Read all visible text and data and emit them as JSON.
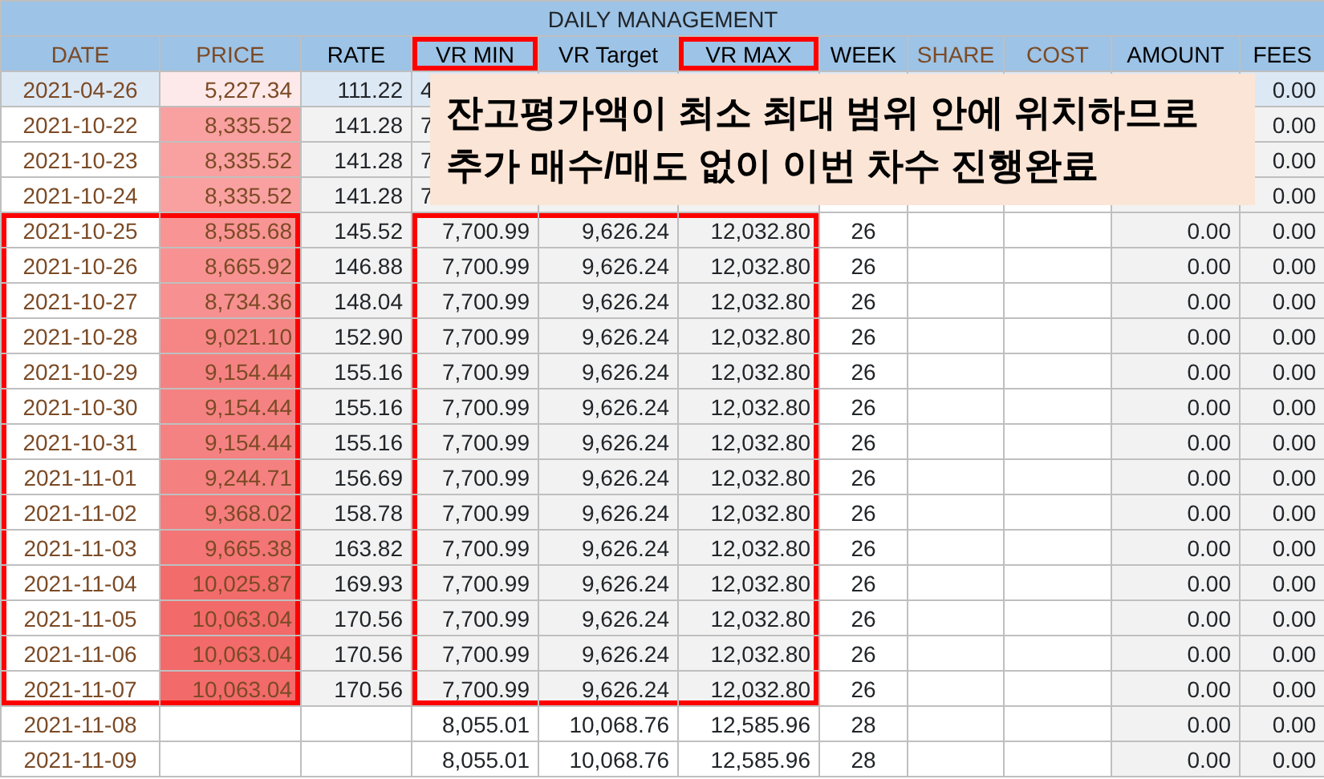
{
  "table": {
    "title": "DAILY MANAGEMENT",
    "columns": [
      {
        "label": "DATE",
        "kind": "input",
        "marked_header": false,
        "marked_body": true
      },
      {
        "label": "PRICE",
        "kind": "input",
        "marked_header": false,
        "marked_body": true
      },
      {
        "label": "RATE",
        "kind": "derived",
        "marked_header": false,
        "marked_body": false
      },
      {
        "label": "VR MIN",
        "kind": "derived",
        "marked_header": true,
        "marked_body": true
      },
      {
        "label": "VR Target",
        "kind": "derived",
        "marked_header": false,
        "marked_body": true
      },
      {
        "label": "VR MAX",
        "kind": "derived",
        "marked_header": true,
        "marked_body": true
      },
      {
        "label": "WEEK",
        "kind": "derived",
        "marked_header": false,
        "marked_body": false
      },
      {
        "label": "SHARE",
        "kind": "input",
        "marked_header": false,
        "marked_body": false
      },
      {
        "label": "COST",
        "kind": "input",
        "marked_header": false,
        "marked_body": false
      },
      {
        "label": "AMOUNT",
        "kind": "derived",
        "marked_header": false,
        "marked_body": false
      },
      {
        "label": "FEES",
        "kind": "derived",
        "marked_header": false,
        "marked_body": false
      }
    ],
    "rows": [
      {
        "kind": "baseline",
        "marked": false,
        "color": "#fde9e9",
        "cells": [
          "2021-04-26",
          "5,227.34",
          "111.22",
          "4",
          null,
          null,
          null,
          null,
          null,
          null,
          "0.00"
        ]
      },
      {
        "kind": "daily",
        "marked": false,
        "color": "#f9a0a0",
        "cells": [
          "2021-10-22",
          "8,335.52",
          "141.28",
          "7",
          null,
          null,
          null,
          null,
          null,
          null,
          "0.00"
        ]
      },
      {
        "kind": "daily",
        "marked": false,
        "color": "#f9a0a0",
        "cells": [
          "2021-10-23",
          "8,335.52",
          "141.28",
          "7",
          null,
          null,
          null,
          null,
          null,
          null,
          "0.00"
        ]
      },
      {
        "kind": "daily",
        "marked": false,
        "color": "#f9a0a0",
        "cells": [
          "2021-10-24",
          "8,335.52",
          "141.28",
          "7",
          null,
          null,
          null,
          null,
          null,
          null,
          "0.00"
        ]
      },
      {
        "kind": "daily",
        "marked": true,
        "color": "#f89494",
        "cells": [
          "2021-10-25",
          "8,585.68",
          "145.52",
          "7,700.99",
          "9,626.24",
          "12,032.80",
          "26",
          null,
          null,
          "0.00",
          "0.00"
        ]
      },
      {
        "kind": "daily",
        "marked": true,
        "color": "#f89292",
        "cells": [
          "2021-10-26",
          "8,665.92",
          "146.88",
          "7,700.99",
          "9,626.24",
          "12,032.80",
          "26",
          null,
          null,
          "0.00",
          "0.00"
        ]
      },
      {
        "kind": "daily",
        "marked": true,
        "color": "#f79090",
        "cells": [
          "2021-10-27",
          "8,734.36",
          "148.04",
          "7,700.99",
          "9,626.24",
          "12,032.80",
          "26",
          null,
          null,
          "0.00",
          "0.00"
        ]
      },
      {
        "kind": "daily",
        "marked": true,
        "color": "#f68686",
        "cells": [
          "2021-10-28",
          "9,021.10",
          "152.90",
          "7,700.99",
          "9,626.24",
          "12,032.80",
          "26",
          null,
          null,
          "0.00",
          "0.00"
        ]
      },
      {
        "kind": "daily",
        "marked": true,
        "color": "#f58282",
        "cells": [
          "2021-10-29",
          "9,154.44",
          "155.16",
          "7,700.99",
          "9,626.24",
          "12,032.80",
          "26",
          null,
          null,
          "0.00",
          "0.00"
        ]
      },
      {
        "kind": "daily",
        "marked": true,
        "color": "#f58282",
        "cells": [
          "2021-10-30",
          "9,154.44",
          "155.16",
          "7,700.99",
          "9,626.24",
          "12,032.80",
          "26",
          null,
          null,
          "0.00",
          "0.00"
        ]
      },
      {
        "kind": "daily",
        "marked": true,
        "color": "#f58282",
        "cells": [
          "2021-10-31",
          "9,154.44",
          "155.16",
          "7,700.99",
          "9,626.24",
          "12,032.80",
          "26",
          null,
          null,
          "0.00",
          "0.00"
        ]
      },
      {
        "kind": "daily",
        "marked": true,
        "color": "#f58080",
        "cells": [
          "2021-11-01",
          "9,244.71",
          "156.69",
          "7,700.99",
          "9,626.24",
          "12,032.80",
          "26",
          null,
          null,
          "0.00",
          "0.00"
        ]
      },
      {
        "kind": "daily",
        "marked": true,
        "color": "#f47c7c",
        "cells": [
          "2021-11-02",
          "9,368.02",
          "158.78",
          "7,700.99",
          "9,626.24",
          "12,032.80",
          "26",
          null,
          null,
          "0.00",
          "0.00"
        ]
      },
      {
        "kind": "daily",
        "marked": true,
        "color": "#f37575",
        "cells": [
          "2021-11-03",
          "9,665.38",
          "163.82",
          "7,700.99",
          "9,626.24",
          "12,032.80",
          "26",
          null,
          null,
          "0.00",
          "0.00"
        ]
      },
      {
        "kind": "daily",
        "marked": true,
        "color": "#f26c6c",
        "cells": [
          "2021-11-04",
          "10,025.87",
          "169.93",
          "7,700.99",
          "9,626.24",
          "12,032.80",
          "26",
          null,
          null,
          "0.00",
          "0.00"
        ]
      },
      {
        "kind": "daily",
        "marked": true,
        "color": "#f26a6a",
        "cells": [
          "2021-11-05",
          "10,063.04",
          "170.56",
          "7,700.99",
          "9,626.24",
          "12,032.80",
          "26",
          null,
          null,
          "0.00",
          "0.00"
        ]
      },
      {
        "kind": "daily",
        "marked": true,
        "color": "#f26a6a",
        "cells": [
          "2021-11-06",
          "10,063.04",
          "170.56",
          "7,700.99",
          "9,626.24",
          "12,032.80",
          "26",
          null,
          null,
          "0.00",
          "0.00"
        ]
      },
      {
        "kind": "daily",
        "marked": true,
        "color": "#f26a6a",
        "cells": [
          "2021-11-07",
          "10,063.04",
          "170.56",
          "7,700.99",
          "9,626.24",
          "12,032.80",
          "26",
          null,
          null,
          "0.00",
          "0.00"
        ]
      },
      {
        "kind": "future",
        "marked": false,
        "cells": [
          "2021-11-08",
          null,
          null,
          "8,055.01",
          "10,068.76",
          "12,585.96",
          "28",
          null,
          null,
          "0.00",
          "0.00"
        ]
      },
      {
        "kind": "future",
        "marked": false,
        "cells": [
          "2021-11-09",
          null,
          null,
          "8,055.01",
          "10,068.76",
          "12,585.96",
          "28",
          null,
          null,
          "0.00",
          "0.00"
        ]
      }
    ]
  },
  "callout": {
    "lines": [
      "잔고평가액이 최소 최대 범위 안에 위치하므로",
      "추가 매수/매도 없이 이번 차수 진행완료"
    ]
  }
}
